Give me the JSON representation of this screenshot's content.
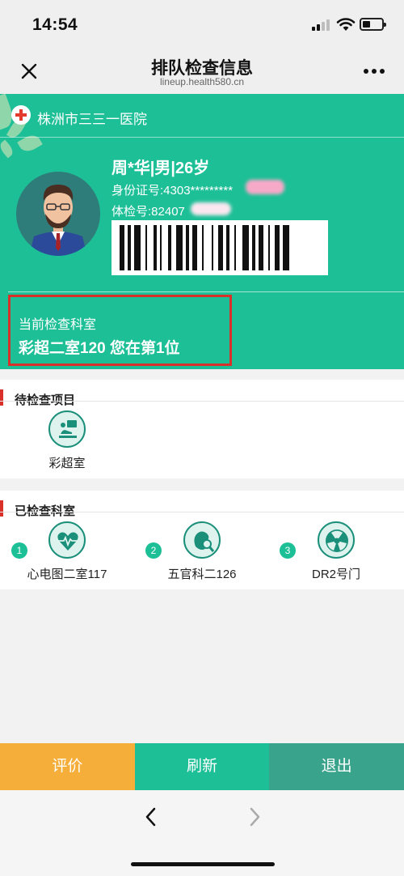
{
  "status_bar": {
    "time": "14:54"
  },
  "nav": {
    "title": "排队检查信息",
    "subtitle": "lineup.health580.cn"
  },
  "hospital": {
    "name": "株洲市三三一医院"
  },
  "patient": {
    "name_line": "周*华|男|26岁",
    "id_label": "身份证号:4303*********",
    "exam_label": "体检号:82407"
  },
  "current": {
    "label": "当前检查科室",
    "status": "彩超二室120 您在第1位"
  },
  "pending": {
    "title": "待检查项目",
    "items": [
      {
        "label": "彩超室",
        "icon": "ultrasound-icon"
      }
    ]
  },
  "completed": {
    "title": "已检查科室",
    "items": [
      {
        "num": "1",
        "label": "心电图二室117",
        "icon": "heart-ecg-icon"
      },
      {
        "num": "2",
        "label": "五官科二126",
        "icon": "ent-icon"
      },
      {
        "num": "3",
        "label": "DR2号门",
        "icon": "radiation-icon"
      }
    ]
  },
  "buttons": {
    "rate": "评价",
    "refresh": "刷新",
    "exit": "退出"
  },
  "colors": {
    "primary": "#1dbf97",
    "rate": "#f6ae3a",
    "exit": "#3aa38b",
    "highlight": "#d9312a"
  }
}
